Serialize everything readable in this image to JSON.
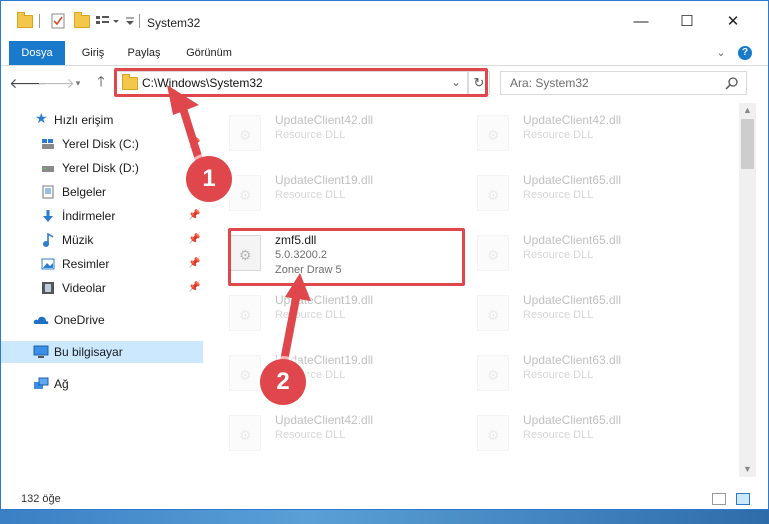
{
  "window": {
    "title": "System32",
    "minimize_glyph": "—",
    "maximize_glyph": "☐",
    "close_glyph": "✕"
  },
  "ribbon": {
    "tabs": [
      "Dosya",
      "Giriş",
      "Paylaş",
      "Görünüm"
    ],
    "collapse_glyph": "⌄",
    "help_glyph": "?"
  },
  "address": {
    "path": "C:\\Windows\\System32",
    "search_placeholder": "Ara: System32",
    "refresh_glyph": "↻",
    "dropdown_glyph": "⌄"
  },
  "sidebar": {
    "quick_access": "Hızlı erişim",
    "items": [
      {
        "label": "Yerel Disk (C:)",
        "icon": "drive-icon"
      },
      {
        "label": "Yerel Disk (D:)",
        "icon": "drive-icon"
      },
      {
        "label": "Belgeler",
        "icon": "documents-icon"
      },
      {
        "label": "İndirmeler",
        "icon": "downloads-icon"
      },
      {
        "label": "Müzik",
        "icon": "music-icon"
      },
      {
        "label": "Resimler",
        "icon": "pictures-icon"
      },
      {
        "label": "Videolar",
        "icon": "videos-icon"
      }
    ],
    "onedrive": "OneDrive",
    "this_pc": "Bu bilgisayar",
    "network": "Ağ"
  },
  "files": {
    "left_column": [
      {
        "name": "UpdateClient42.dll",
        "type": "Resource DLL"
      },
      {
        "name": "UpdateClient19.dll",
        "type": "Resource DLL"
      },
      {
        "name": "zmf5.dll",
        "version": "5.0.3200.2",
        "type": "Zoner Draw 5"
      },
      {
        "name": "UpdateClient19.dll",
        "type": "Resource DLL"
      },
      {
        "name": "UpdateClient19.dll",
        "type": "Resource DLL"
      },
      {
        "name": "UpdateClient42.dll",
        "type": "Resource DLL"
      }
    ],
    "right_column": [
      {
        "name": "UpdateClient42.dll",
        "type": "Resource DLL"
      },
      {
        "name": "UpdateClient65.dll",
        "type": "Resource DLL"
      },
      {
        "name": "UpdateClient65.dll",
        "type": "Resource DLL"
      },
      {
        "name": "UpdateClient65.dll",
        "type": "Resource DLL"
      },
      {
        "name": "UpdateClient63.dll",
        "type": "Resource DLL"
      },
      {
        "name": "UpdateClient65.dll",
        "type": "Resource DLL"
      }
    ]
  },
  "status": {
    "item_count": "132 öğe"
  },
  "annotations": {
    "step1": "1",
    "step2": "2",
    "color": "#e0474c"
  }
}
